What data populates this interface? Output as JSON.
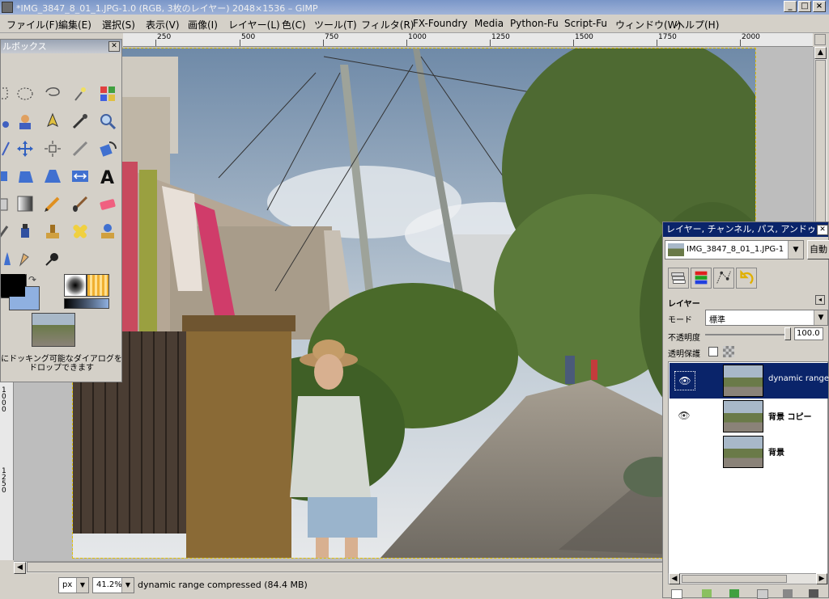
{
  "window": {
    "title": "*IMG_3847_8_01_1.JPG-1.0 (RGB, 3枚のレイヤー) 2048×1536 – GIMP",
    "btn_min": "_",
    "btn_max": "□",
    "btn_close": "×"
  },
  "menu": [
    "ファイル(F)",
    "編集(E)",
    "選択(S)",
    "表示(V)",
    "画像(I)",
    "レイヤー(L)",
    "色(C)",
    "ツール(T)",
    "フィルタ(R)",
    "FX-Foundry",
    "Media",
    "Python-Fu",
    "Script-Fu",
    "ウィンドウ(W)",
    "ヘルプ(H)"
  ],
  "ruler": {
    "h_labels": [
      "250",
      "500",
      "750",
      "1000",
      "1250",
      "1500",
      "1750",
      "2000"
    ],
    "v_labels": [
      "1000",
      "1250"
    ]
  },
  "toolbox": {
    "title": "ルボックス",
    "hint": "にドッキング可能なダイアログをドロップできます"
  },
  "status": {
    "unit": "px",
    "zoom": "41.2%",
    "message": "dynamic range compressed (84.4 MB)"
  },
  "layers_dock": {
    "title": "レイヤー, チャンネル, パス, アンドゥ",
    "image_select": "IMG_3847_8_01_1.JPG-1",
    "auto_button": "自動",
    "section_label": "レイヤー",
    "mode_label": "モード",
    "mode_value": "標準",
    "opacity_label": "不透明度",
    "opacity_value": "100.0",
    "lock_label": "透明保護",
    "layers": [
      {
        "name": "dynamic range co",
        "visible": true,
        "selected": true
      },
      {
        "name": "背景 コピー",
        "visible": true,
        "selected": false
      },
      {
        "name": "背景",
        "visible": false,
        "selected": false
      }
    ]
  },
  "colors": {
    "title_active": "#0a246a",
    "fg": "#000000",
    "bg": "#8fb0e0",
    "selection_edge": "#e0c000"
  }
}
